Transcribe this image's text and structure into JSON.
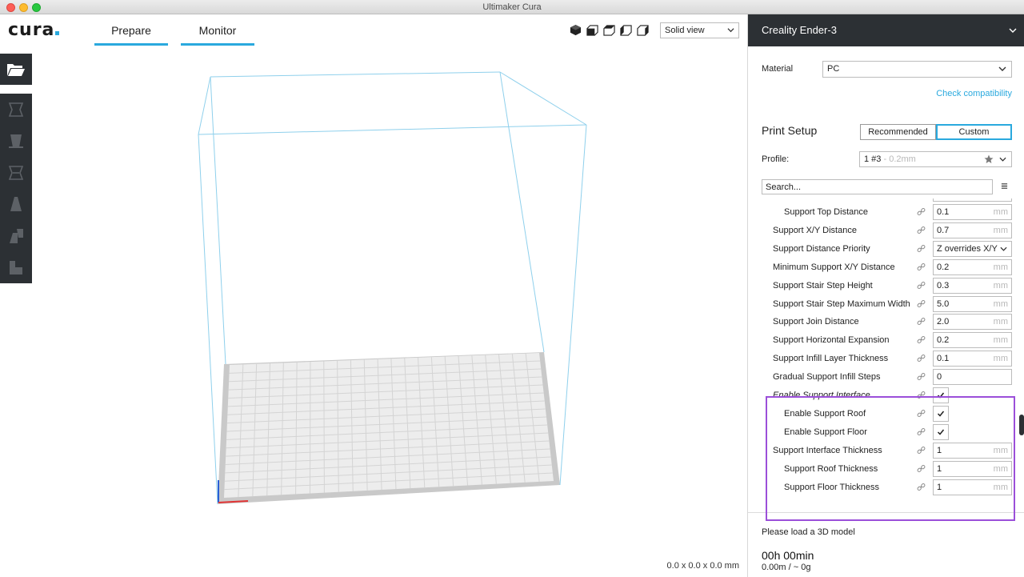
{
  "window": {
    "title": "Ultimaker Cura"
  },
  "logo": {
    "text": "cura",
    "accent": "#2aa9de"
  },
  "nav": {
    "prepare": "Prepare",
    "monitor": "Monitor"
  },
  "view": {
    "icons": [
      "3d-view-icon",
      "front-view-icon",
      "top-view-icon",
      "left-view-icon",
      "right-view-icon"
    ],
    "mode": "Solid view"
  },
  "viewport": {
    "dimensions": "0.0 x 0.0 x 0.0 mm"
  },
  "sidebar": {
    "printer": "Creality Ender-3",
    "material_label": "Material",
    "material_value": "PC",
    "check_compatibility": "Check compatibility",
    "print_setup": "Print Setup",
    "mode_recommended": "Recommended",
    "mode_custom": "Custom",
    "profile_label": "Profile:",
    "profile_name": "1 #3",
    "profile_sub": " - 0.2mm",
    "search_placeholder": "Search...",
    "settings": [
      {
        "label": "Support Top Distance",
        "indent": 1,
        "value": "0.1",
        "unit": "mm",
        "kind": "input"
      },
      {
        "label": "Support X/Y Distance",
        "indent": 0,
        "value": "0.7",
        "unit": "mm",
        "kind": "input"
      },
      {
        "label": "Support Distance Priority",
        "indent": 0,
        "value": "Z overrides X/Y",
        "unit": "",
        "kind": "select"
      },
      {
        "label": "Minimum Support X/Y Distance",
        "indent": 0,
        "value": "0.2",
        "unit": "mm",
        "kind": "input"
      },
      {
        "label": "Support Stair Step Height",
        "indent": 0,
        "value": "0.3",
        "unit": "mm",
        "kind": "input"
      },
      {
        "label": "Support Stair Step Maximum Width",
        "indent": 0,
        "value": "5.0",
        "unit": "mm",
        "kind": "input"
      },
      {
        "label": "Support Join Distance",
        "indent": 0,
        "value": "2.0",
        "unit": "mm",
        "kind": "input"
      },
      {
        "label": "Support Horizontal Expansion",
        "indent": 0,
        "value": "0.2",
        "unit": "mm",
        "kind": "input"
      },
      {
        "label": "Support Infill Layer Thickness",
        "indent": 0,
        "value": "0.1",
        "unit": "mm",
        "kind": "input"
      },
      {
        "label": "Gradual Support Infill Steps",
        "indent": 0,
        "value": "0",
        "unit": "",
        "kind": "input"
      },
      {
        "label": "Enable Support Interface",
        "indent": 0,
        "value": "",
        "unit": "",
        "kind": "checkbox",
        "italic": true
      },
      {
        "label": "Enable Support Roof",
        "indent": 1,
        "value": "",
        "unit": "",
        "kind": "checkbox"
      },
      {
        "label": "Enable Support Floor",
        "indent": 1,
        "value": "",
        "unit": "",
        "kind": "checkbox"
      },
      {
        "label": "Support Interface Thickness",
        "indent": 0,
        "value": "1",
        "unit": "mm",
        "kind": "input"
      },
      {
        "label": "Support Roof Thickness",
        "indent": 1,
        "value": "1",
        "unit": "mm",
        "kind": "input"
      },
      {
        "label": "Support Floor Thickness",
        "indent": 1,
        "value": "1",
        "unit": "mm",
        "kind": "input"
      }
    ],
    "load_message": "Please load a 3D model",
    "print_time": "00h 00min",
    "material_estimate": "0.00m / ~ 0g"
  },
  "colors": {
    "accent": "#2aa9de",
    "dark": "#2c3034",
    "highlight": "#9b4fd9"
  }
}
